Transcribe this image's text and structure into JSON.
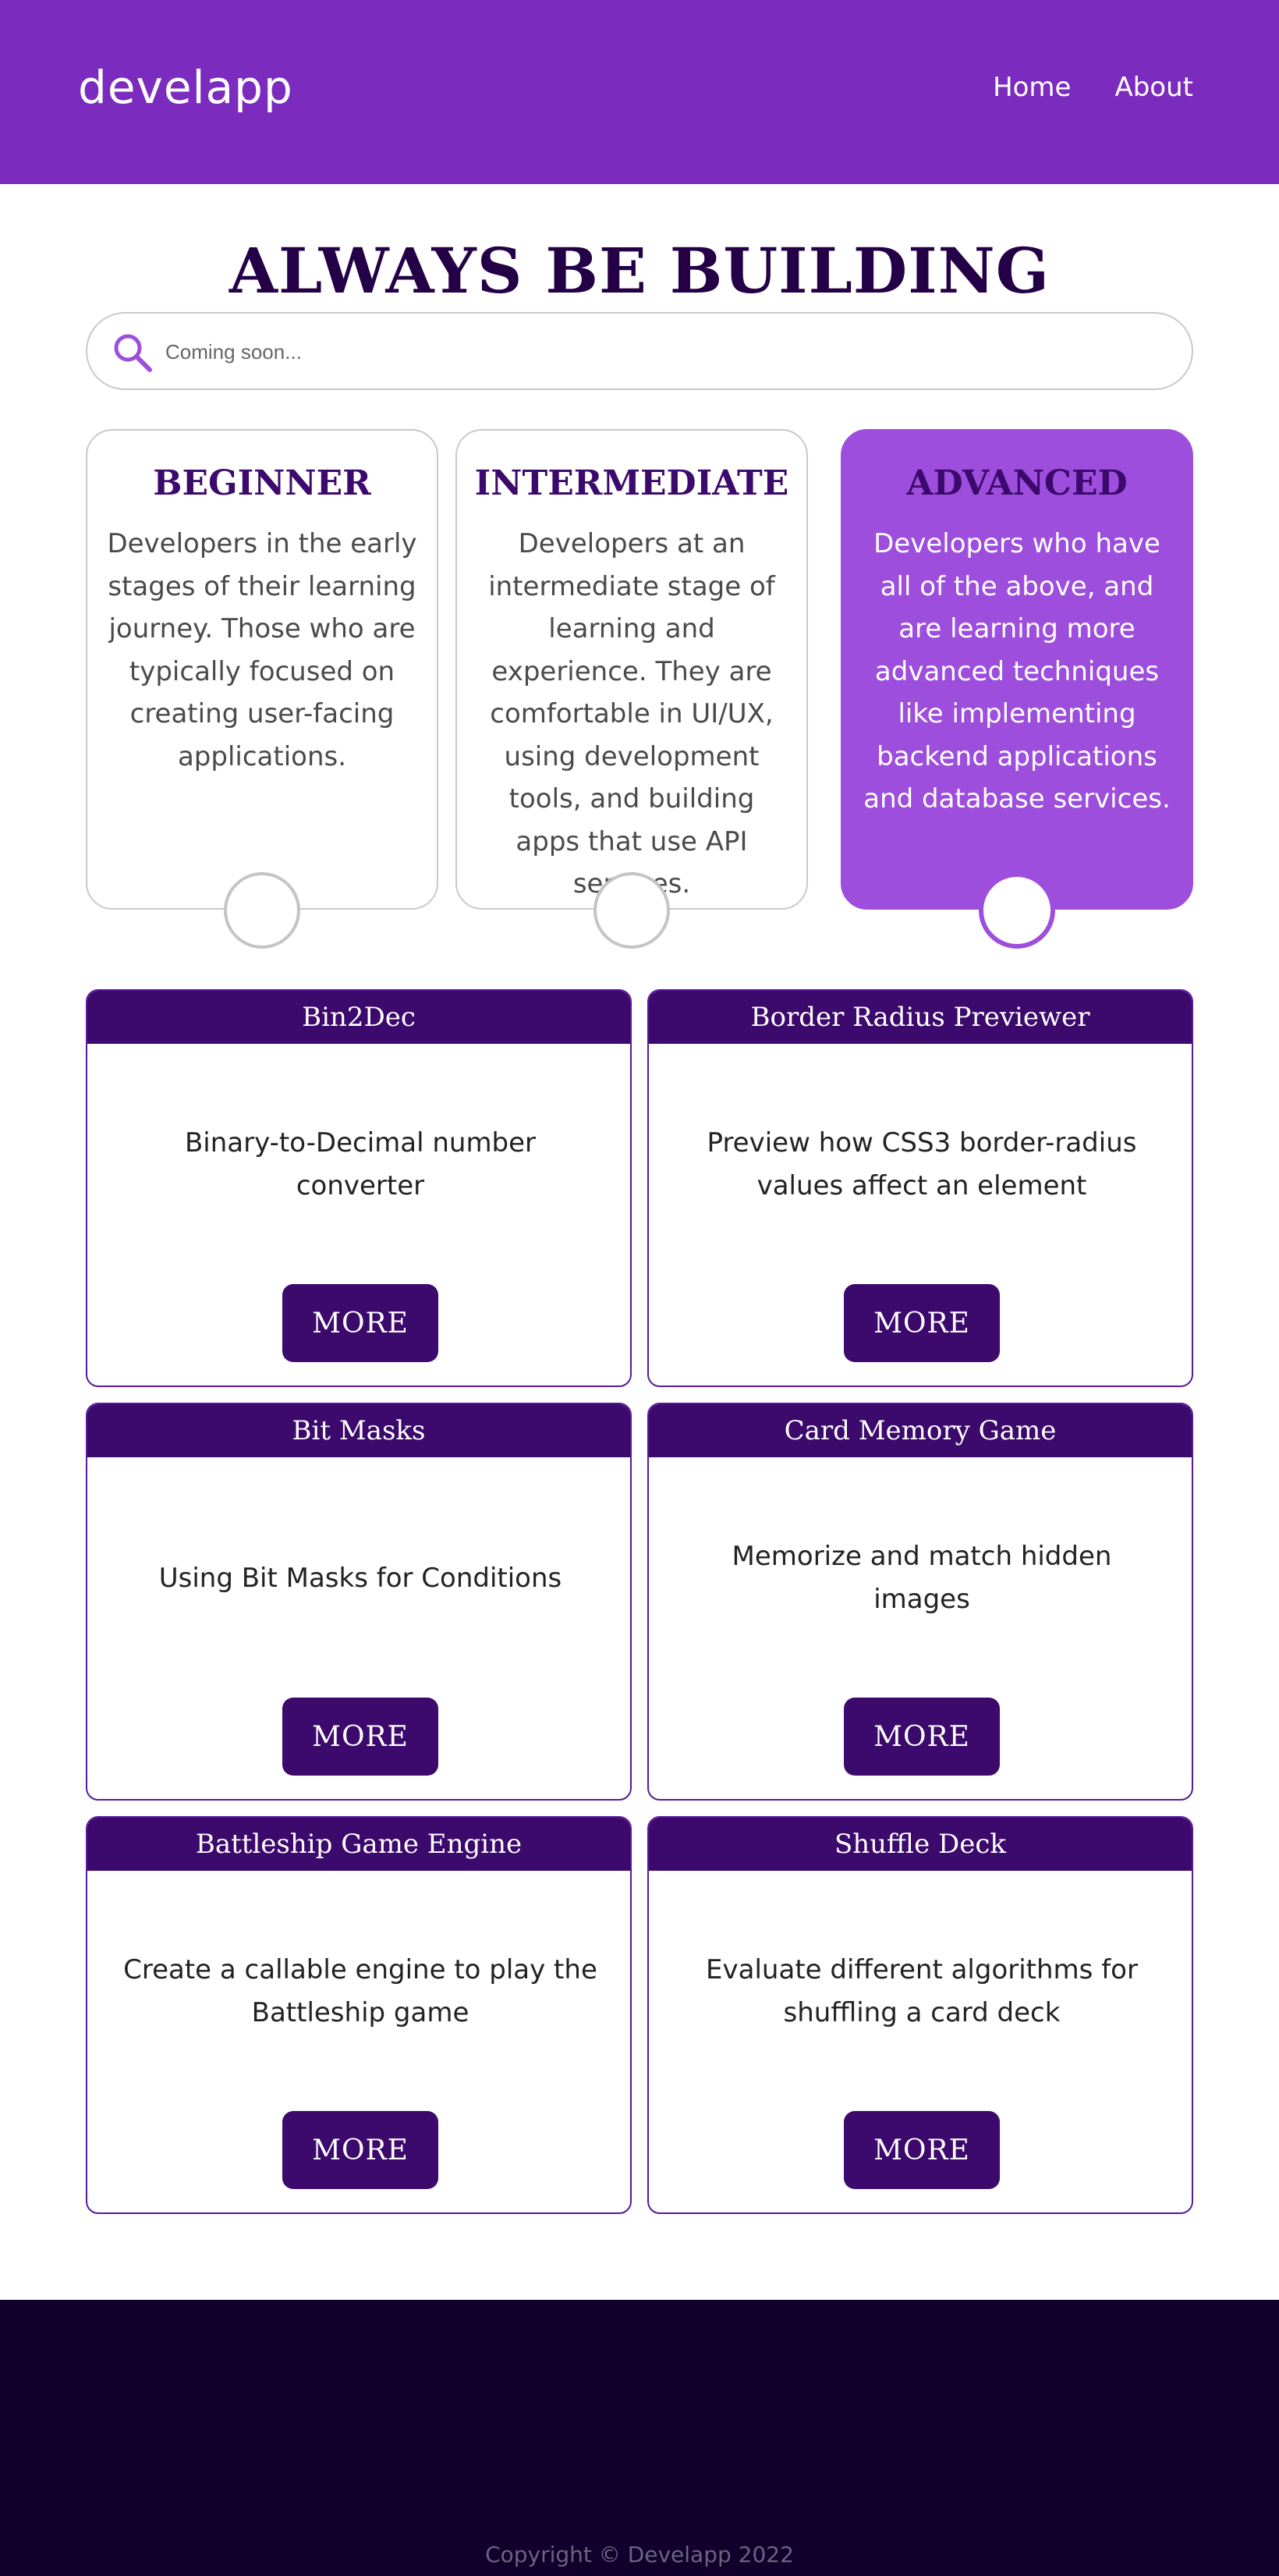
{
  "header": {
    "logo": "develapp",
    "nav": [
      {
        "label": "Home"
      },
      {
        "label": "About"
      }
    ]
  },
  "main": {
    "title": "ALWAYS BE BUILDING",
    "search": {
      "placeholder": "Coming soon...",
      "icon": "search-icon"
    }
  },
  "levels": [
    {
      "title": "BEGINNER",
      "description": "Developers in the early stages of their learning journey. Those who are typically focused on creating user-facing applications.",
      "selected": false
    },
    {
      "title": "INTERMEDIATE",
      "description": "Developers at an intermediate stage of learning and experience. They are comfortable in UI/UX, using development tools, and building apps that use API services.",
      "selected": false
    },
    {
      "title": "ADVANCED",
      "description": "Developers who have all of the above, and are learning more advanced techniques like implementing backend applications and database services.",
      "selected": true
    }
  ],
  "projects": [
    {
      "title": "Bin2Dec",
      "description": "Binary-to-Decimal number converter",
      "button": "MORE"
    },
    {
      "title": "Border Radius Previewer",
      "description": "Preview how CSS3 border-radius values affect an element",
      "button": "MORE"
    },
    {
      "title": "Bit Masks",
      "description": "Using Bit Masks for Conditions",
      "button": "MORE"
    },
    {
      "title": "Card Memory Game",
      "description": "Memorize and match hidden images",
      "button": "MORE"
    },
    {
      "title": "Battleship Game Engine",
      "description": "Create a callable engine to play the Battleship game",
      "button": "MORE"
    },
    {
      "title": "Shuffle Deck",
      "description": "Evaluate different algorithms for shuffling a card deck",
      "button": "MORE"
    }
  ],
  "footer": {
    "copyright": "Copyright © Develapp 2022"
  },
  "colors": {
    "header": "#7b2cbf",
    "accent": "#9d4edd",
    "dark": "#3c096c",
    "footer": "#10002b"
  }
}
